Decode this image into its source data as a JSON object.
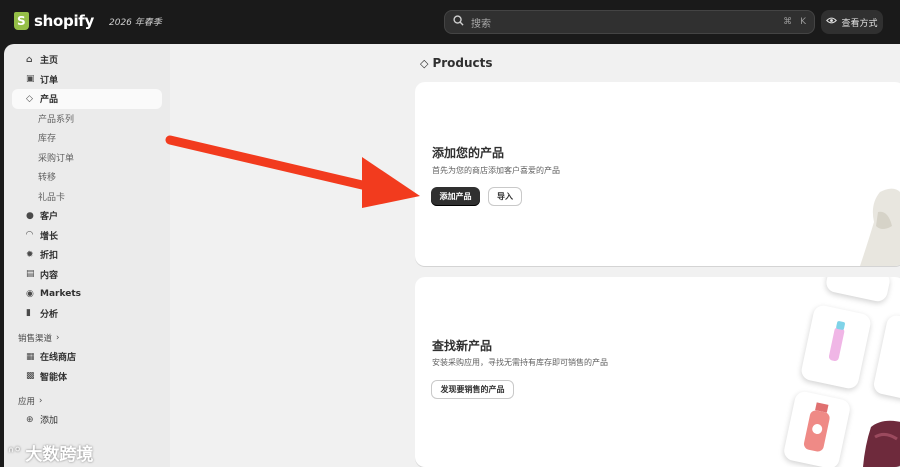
{
  "topbar": {
    "brand": "shopify",
    "edition": "2026 年春季",
    "search_placeholder": "搜索",
    "search_shortcut_cmd": "⌘",
    "search_shortcut_key": "K",
    "view_mode_label": "查看方式"
  },
  "sidebar": {
    "items": [
      {
        "label": "主页",
        "icon": "home-icon"
      },
      {
        "label": "订单",
        "icon": "inbox-icon"
      },
      {
        "label": "产品",
        "icon": "tag-icon"
      }
    ],
    "product_sub": [
      "产品系列",
      "库存",
      "采购订单",
      "转移",
      "礼品卡"
    ],
    "items2": [
      {
        "label": "客户",
        "icon": "person-icon"
      },
      {
        "label": "增长",
        "icon": "gauge-icon"
      },
      {
        "label": "折扣",
        "icon": "discount-icon"
      },
      {
        "label": "内容",
        "icon": "content-icon"
      },
      {
        "label": "Markets",
        "icon": "globe-icon"
      },
      {
        "label": "分析",
        "icon": "chart-icon"
      }
    ],
    "sales_channels_label": "销售渠道",
    "channels": [
      {
        "label": "在线商店",
        "icon": "store-icon"
      },
      {
        "label": "智能体",
        "icon": "agent-icon"
      }
    ],
    "apps_label": "应用",
    "add_label": "添加"
  },
  "watermark": "大数跨境",
  "main": {
    "page_title": "Products",
    "card1": {
      "title": "添加您的产品",
      "desc": "首先为您的商店添加客户喜爱的产品",
      "primary_button": "添加产品",
      "secondary_button": "导入"
    },
    "card2": {
      "title": "查找新产品",
      "desc": "安装采购应用，寻找无需持有库存即可销售的产品",
      "button": "发现要销售的产品"
    }
  },
  "colors": {
    "arrow": "#f23b1e",
    "shopify_green": "#95bf47",
    "primary_button": "#303030"
  }
}
